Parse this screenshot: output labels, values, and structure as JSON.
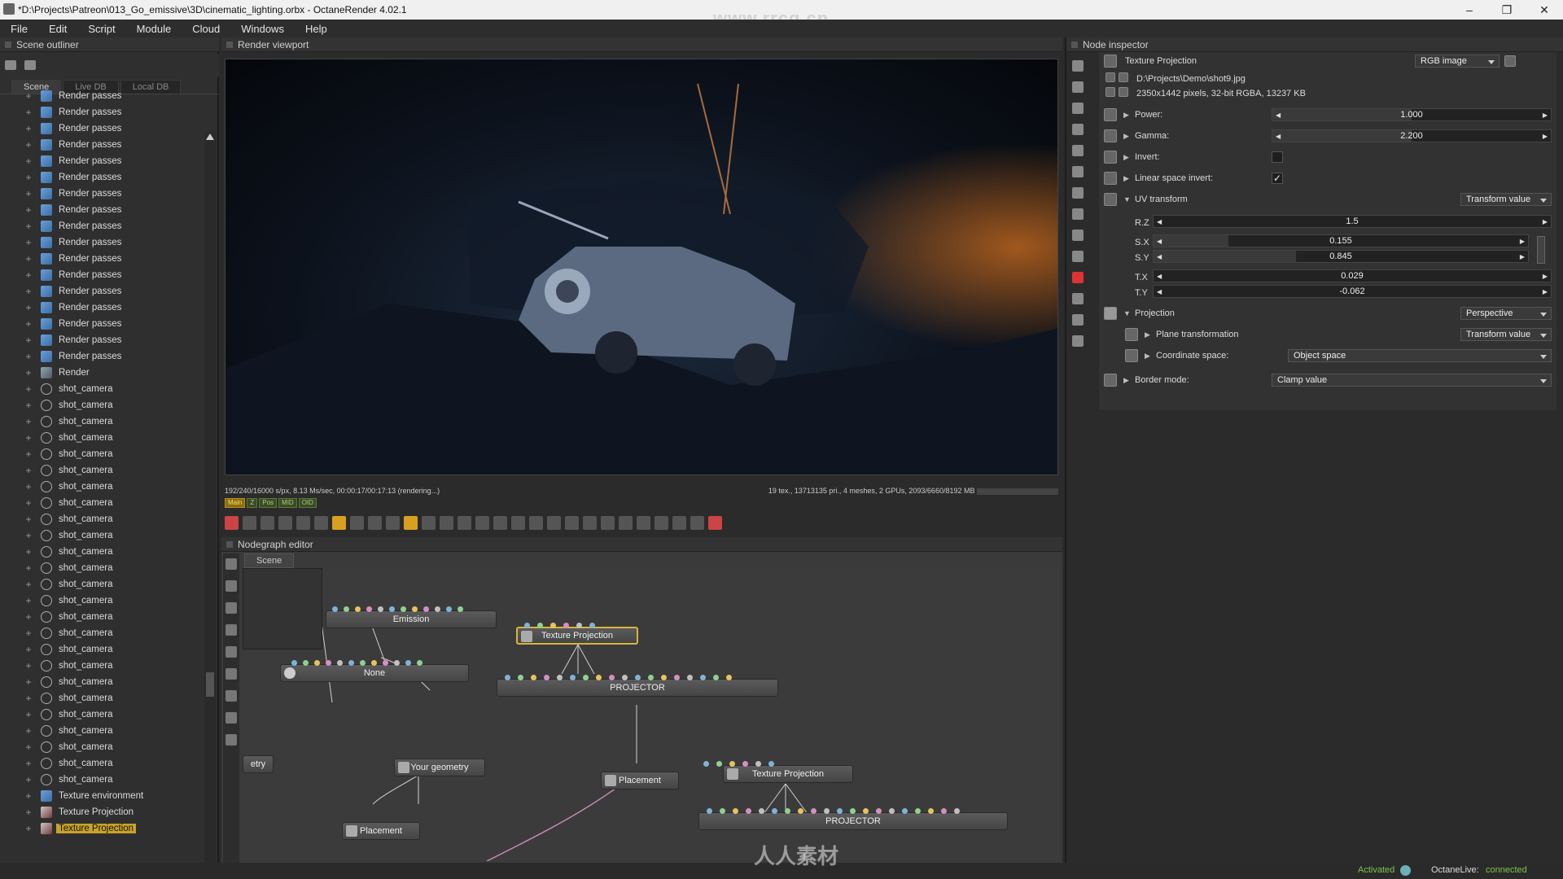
{
  "window": {
    "title": "*D:\\Projects\\Patreon\\013_Go_emissive\\3D\\cinematic_lighting.orbx - OctaneRender 4.02.1",
    "watermark": "www.rrcg.cn",
    "controls": [
      "–",
      "❐",
      "✕"
    ]
  },
  "menu": [
    "File",
    "Edit",
    "Script",
    "Module",
    "Cloud",
    "Windows",
    "Help"
  ],
  "outliner": {
    "title": "Scene outliner",
    "tabs": [
      "Scene",
      "Live DB",
      "Local DB"
    ],
    "items": [
      {
        "label": "Render passes",
        "kind": "pass"
      },
      {
        "label": "Render passes",
        "kind": "pass"
      },
      {
        "label": "Render passes",
        "kind": "pass"
      },
      {
        "label": "Render passes",
        "kind": "pass"
      },
      {
        "label": "Render passes",
        "kind": "pass"
      },
      {
        "label": "Render passes",
        "kind": "pass"
      },
      {
        "label": "Render passes",
        "kind": "pass"
      },
      {
        "label": "Render passes",
        "kind": "pass"
      },
      {
        "label": "Render passes",
        "kind": "pass"
      },
      {
        "label": "Render passes",
        "kind": "pass"
      },
      {
        "label": "Render passes",
        "kind": "pass"
      },
      {
        "label": "Render passes",
        "kind": "pass"
      },
      {
        "label": "Render passes",
        "kind": "pass"
      },
      {
        "label": "Render passes",
        "kind": "pass"
      },
      {
        "label": "Render passes",
        "kind": "pass"
      },
      {
        "label": "Render passes",
        "kind": "pass"
      },
      {
        "label": "Render passes",
        "kind": "pass"
      },
      {
        "label": "Render",
        "kind": "render"
      },
      {
        "label": "shot_camera",
        "kind": "cam"
      },
      {
        "label": "shot_camera",
        "kind": "cam"
      },
      {
        "label": "shot_camera",
        "kind": "cam"
      },
      {
        "label": "shot_camera",
        "kind": "cam"
      },
      {
        "label": "shot_camera",
        "kind": "cam"
      },
      {
        "label": "shot_camera",
        "kind": "cam"
      },
      {
        "label": "shot_camera",
        "kind": "cam"
      },
      {
        "label": "shot_camera",
        "kind": "cam"
      },
      {
        "label": "shot_camera",
        "kind": "cam"
      },
      {
        "label": "shot_camera",
        "kind": "cam"
      },
      {
        "label": "shot_camera",
        "kind": "cam"
      },
      {
        "label": "shot_camera",
        "kind": "cam"
      },
      {
        "label": "shot_camera",
        "kind": "cam"
      },
      {
        "label": "shot_camera",
        "kind": "cam"
      },
      {
        "label": "shot_camera",
        "kind": "cam"
      },
      {
        "label": "shot_camera",
        "kind": "cam"
      },
      {
        "label": "shot_camera",
        "kind": "cam"
      },
      {
        "label": "shot_camera",
        "kind": "cam"
      },
      {
        "label": "shot_camera",
        "kind": "cam"
      },
      {
        "label": "shot_camera",
        "kind": "cam"
      },
      {
        "label": "shot_camera",
        "kind": "cam"
      },
      {
        "label": "shot_camera",
        "kind": "cam"
      },
      {
        "label": "shot_camera",
        "kind": "cam"
      },
      {
        "label": "shot_camera",
        "kind": "cam"
      },
      {
        "label": "shot_camera",
        "kind": "cam"
      },
      {
        "label": "Texture environment",
        "kind": "pass"
      },
      {
        "label": "Texture Projection",
        "kind": "tex"
      },
      {
        "label": "Texture Projection",
        "kind": "tex",
        "selected": true
      }
    ]
  },
  "viewport": {
    "title": "Render viewport",
    "stats_left": "192/240/16000 s/px, 8.13 Ms/sec, 00:00:17/00:17:13 (rendering...)",
    "stats_right": "19 tex., 13713135 pri., 4 meshes, 2 GPUs, 2093/6660/8192 MB",
    "pass_tabs": [
      "Main",
      "Z",
      "Pos",
      "MID",
      "OID"
    ]
  },
  "nodegraph": {
    "title": "Nodegraph editor",
    "tab": "Scene",
    "nodes": {
      "emission": "Emission",
      "none": "None",
      "tex1": "Texture Projection",
      "projector1": "PROJECTOR",
      "geometry": "Your geometry",
      "placement1": "Placement",
      "placement2": "Placement",
      "tex2": "Texture Projection",
      "projector2": "PROJECTOR",
      "etry": "etry"
    }
  },
  "inspector": {
    "title": "Node inspector",
    "node_name": "Texture Projection",
    "output_type": "RGB image",
    "file_path": "D:\\Projects\\Demo\\shot9.jpg",
    "file_info": "2350x1442 pixels, 32-bit RGBA, 13237 KB",
    "params": {
      "power": {
        "label": "Power:",
        "value": "1.000",
        "fraction": 0.5
      },
      "gamma": {
        "label": "Gamma:",
        "value": "2.200",
        "fraction": 0.5
      },
      "invert": {
        "label": "Invert:",
        "checked": false
      },
      "linear": {
        "label": "Linear space invert:",
        "checked": true,
        "mark": "✓"
      },
      "uv": {
        "label": "UV transform",
        "mode": "Transform value",
        "rz": {
          "label": "R.Z",
          "value": "1.5"
        },
        "sx": {
          "label": "S.X",
          "value": "0.155",
          "fraction": 0.2
        },
        "sy": {
          "label": "S.Y",
          "value": "0.845",
          "fraction": 0.38
        },
        "tx": {
          "label": "T.X",
          "value": "0.029"
        },
        "ty": {
          "label": "T.Y",
          "value": "-0.062"
        }
      },
      "projection": {
        "label": "Projection",
        "mode": "Perspective"
      },
      "plane": {
        "label": "Plane transformation",
        "mode": "Transform value"
      },
      "coord": {
        "label": "Coordinate space:",
        "mode": "Object space"
      },
      "border": {
        "label": "Border mode:",
        "mode": "Clamp value"
      }
    }
  },
  "status": {
    "activated": "Activated",
    "octanelive": "OctaneLive:",
    "connected": "connected",
    "watermark": "人人素材"
  }
}
